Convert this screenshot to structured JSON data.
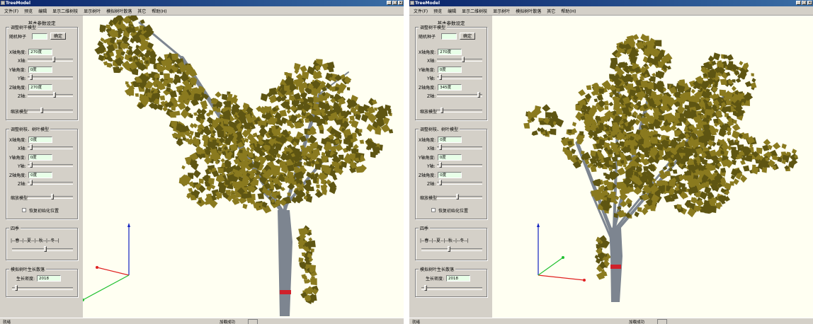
{
  "windows": [
    {
      "id": "left",
      "title": "TreeModel",
      "menu": [
        "文件(F)",
        "预览",
        "编辑",
        "显示二维树枝",
        "显示树叶",
        "模拟树叶散落",
        "其它",
        "帮助(H)"
      ],
      "panel_title": "基本参数设定",
      "group1": {
        "label": "调整树干模型",
        "rand_label": "随机种子",
        "rand_value": "",
        "confirm_button": "确定",
        "angle1_label": "X轴角度:",
        "angle1_value": "270度",
        "axis1": "X轴:",
        "angle2_label": "Y轴角度:",
        "angle2_value": "0度",
        "axis2": "Y轴:",
        "angle3_label": "Z轴角度:",
        "angle3_value": "270度",
        "axis3": "Z轴:",
        "scale_label": "缩放模型"
      },
      "group2": {
        "label": "调整树枝、树叶模型",
        "angle1_label": "X轴角度:",
        "angle1_value": "0度",
        "axis1": "X轴:",
        "angle2_label": "Y轴角度:",
        "angle2_value": "0度",
        "axis2": "Y轴:",
        "angle3_label": "Z轴角度:",
        "angle3_value": "0度",
        "axis3": "Z轴:",
        "scale_label": "缩放模型",
        "checkbox_label": "恢复初始化位置"
      },
      "group3": {
        "label": "四季",
        "seasons": "|--春--|--夏--|--秋--|--冬--|"
      },
      "group4": {
        "label": "模拟树叶生长散落",
        "density_label": "生长密度:",
        "density_value": "2018"
      },
      "sliders": {
        "g1_x": 0.58,
        "g1_y": 0.05,
        "g1_z": 0.6,
        "g1_scale": 0.3,
        "g2_x": 0.05,
        "g2_y": 0.05,
        "g2_z": 0.05,
        "g2_scale": 0.55,
        "season": 0.55,
        "density": 0.05
      },
      "status_left": "就绪",
      "status_center": "加载成功"
    },
    {
      "id": "right",
      "title": "TreeModel",
      "menu": [
        "文件(F)",
        "预览",
        "编辑",
        "显示二维树枝",
        "显示树叶",
        "模拟树叶散落",
        "其它",
        "帮助(H)"
      ],
      "panel_title": "基本参数设定",
      "group1": {
        "label": "调整树干模型",
        "rand_label": "随机种子",
        "rand_value": "",
        "confirm_button": "确定",
        "angle1_label": "X轴角度:",
        "angle1_value": "270度",
        "axis1": "X轴:",
        "angle2_label": "Y轴角度:",
        "angle2_value": "0度",
        "axis2": "Y轴:",
        "angle3_label": "Z轴角度:",
        "angle3_value": "345度",
        "axis3": "Z轴:",
        "scale_label": "缩放模型"
      },
      "group2": {
        "label": "调整树枝、树叶模型",
        "angle1_label": "X轴角度:",
        "angle1_value": "0度",
        "axis1": "X轴:",
        "angle2_label": "Y轴角度:",
        "angle2_value": "0度",
        "axis2": "Y轴:",
        "angle3_label": "Z轴角度:",
        "angle3_value": "0度",
        "axis3": "Z轴:",
        "scale_label": "缩放模型",
        "checkbox_label": "恢复初始化位置"
      },
      "group3": {
        "label": "四季",
        "seasons": "|--春--|--夏--|--秋--|--冬--|"
      },
      "group4": {
        "label": "模拟树叶生长散落",
        "density_label": "生长密度:",
        "density_value": "2018"
      },
      "sliders": {
        "g1_x": 0.58,
        "g1_y": 0.05,
        "g1_z": 0.95,
        "g1_scale": 0.08,
        "g2_x": 0.05,
        "g2_y": 0.05,
        "g2_z": 0.05,
        "g2_scale": 0.45,
        "season": 0.45,
        "density": 0.05
      },
      "status_left": "就绪",
      "status_center": "加载成功"
    }
  ],
  "colors": {
    "leaf": "#8a7a1f",
    "leaf_dark": "#5e5512",
    "trunk": "#7d8590",
    "ring": "#d0202a",
    "axis_x": "#e02020",
    "axis_y": "#20c030",
    "axis_z": "#1020c0",
    "viewport_bg": "#fffff2"
  }
}
